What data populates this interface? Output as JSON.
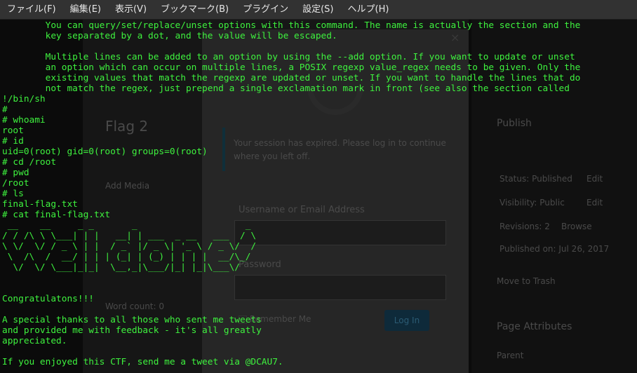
{
  "menubar": {
    "items": [
      "ファイル(F)",
      "編集(E)",
      "表示(V)",
      "ブックマーク(B)",
      "プラグイン",
      "設定(S)",
      "ヘルプ(H)"
    ]
  },
  "background": {
    "post_title": "Flag 2",
    "session_notice": [
      "Your session has expired. Please log in to continue",
      "where you left off."
    ],
    "username_label": "Username or Email Address",
    "password_label": "Password",
    "remember_label": "Remember Me",
    "login_button": "Log In",
    "close_glyph": "×",
    "sidebar": {
      "publish": "Publish",
      "status": "Status: Published",
      "status_edit": "Edit",
      "visibility": "Visibility: Public",
      "visibility_edit": "Edit",
      "revisions": "Revisions: 2",
      "revisions_browse": "Browse",
      "published_on": "Published on: Jul 26, 2017",
      "move_to_trash": "Move to Trash",
      "page_attributes": "Page Attributes",
      "parent": "Parent"
    },
    "add_media": "Add Media",
    "word_count": "Word count: 0"
  },
  "terminal": {
    "lines": [
      "        You can query/set/replace/unset options with this command. The name is actually the section and the",
      "        key separated by a dot, and the value will be escaped.",
      "",
      "        Multiple lines can be added to an option by using the --add option. If you want to update or unset",
      "        an option which can occur on multiple lines, a POSIX regexp value_regex needs to be given. Only the",
      "        existing values that match the regexp are updated or unset. If you want to handle the lines that do",
      "        not match the regex, just prepend a single exclamation mark in front (see also the section called",
      "!/bin/sh",
      "#",
      "# whoami",
      "root",
      "# id",
      "uid=0(root) gid=0(root) groups=0(root)",
      "# cd /root",
      "# pwd",
      "/root",
      "# ls",
      "final-flag.txt",
      "# cat final-flag.txt",
      " __    __     _ _       _                    _ ",
      "/ / /\\ \\ \\___| | |   __| | ___  _ __   ___  / \\",
      "\\ \\/  \\/ / _ \\ | |  / _` |/ _ \\| '_ \\ / _ \\/  /",
      " \\  /\\  /  __/ | | | (_| | (_) | | | |  __/\\_/ ",
      "  \\/  \\/ \\___|_|_|  \\__,_|\\___/|_| |_|\\___\\/   ",
      "",
      "",
      "Congratulatons!!!",
      "",
      "A special thanks to all those who sent me tweets",
      "and provided me with feedback - it's all greatly",
      "appreciated.",
      "",
      "If you enjoyed this CTF, send me a tweet via @DCAU7."
    ]
  }
}
